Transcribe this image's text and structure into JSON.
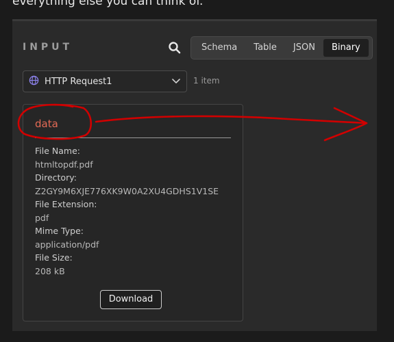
{
  "top_text": "everything else you can think of.",
  "panel": {
    "title": "INPUT",
    "search_icon": "search-icon",
    "tabs": [
      {
        "label": "Schema",
        "active": false
      },
      {
        "label": "Table",
        "active": false
      },
      {
        "label": "JSON",
        "active": false
      },
      {
        "label": "Binary",
        "active": true
      }
    ],
    "node_select": {
      "icon": "globe-icon",
      "value": "HTTP Request1",
      "chevron": "chevron-down-icon"
    },
    "item_count": "1 item"
  },
  "binary_card": {
    "title": "data",
    "fields": [
      {
        "label": "File Name:",
        "value": "htmltopdf.pdf"
      },
      {
        "label": "Directory:",
        "value": "Z2GY9M6XJE776XK9W0A2XU4GDHS1V1SE"
      },
      {
        "label": "File Extension:",
        "value": "pdf"
      },
      {
        "label": "Mime Type:",
        "value": "application/pdf"
      },
      {
        "label": "File Size:",
        "value": "208 kB"
      }
    ],
    "download_label": "Download"
  },
  "annotation_color": "#d10000",
  "colors": {
    "accent": "#e46a55",
    "background": "#1b1b1b",
    "panel": "#2a2a2a"
  }
}
